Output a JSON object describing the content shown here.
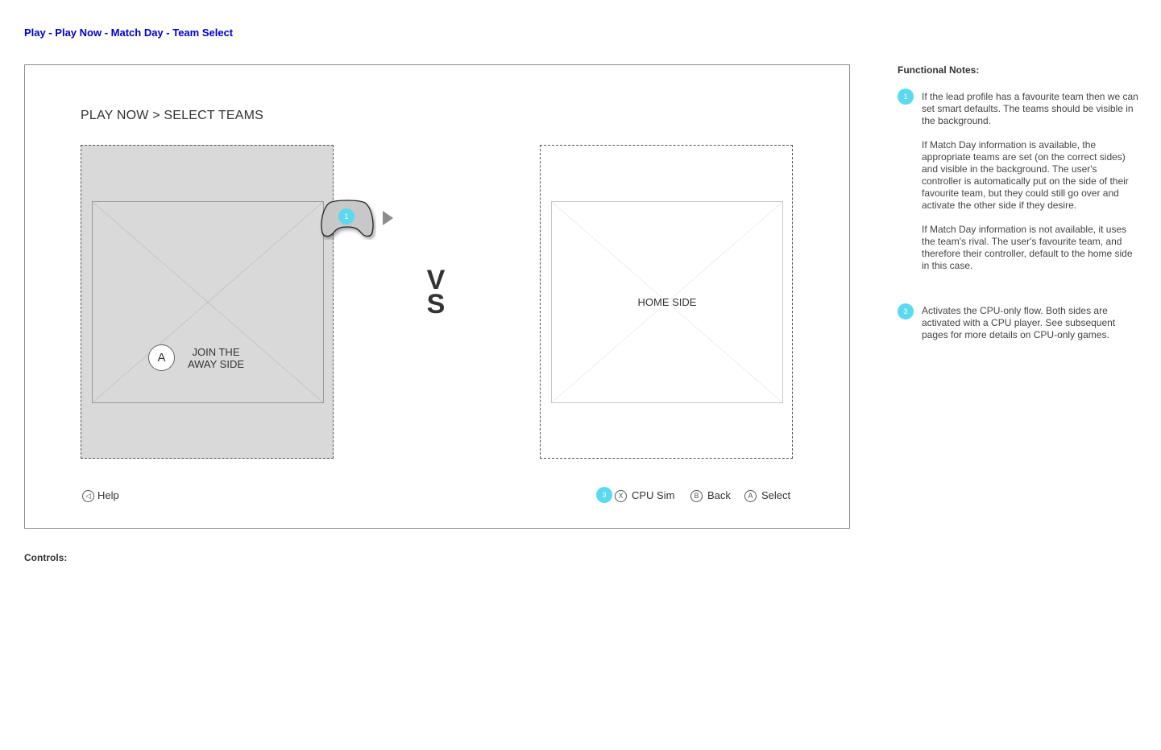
{
  "breadcrumb": "Play - Play Now - Match Day - Team Select",
  "screen": {
    "title": "PLAY NOW > SELECT TEAMS",
    "away_panel": {
      "button_glyph": "A",
      "label_line1": "JOIN THE",
      "label_line2": "AWAY SIDE"
    },
    "home_panel": {
      "label": "HOME SIDE"
    },
    "controller": {
      "icon": "gamepad-icon",
      "badge": "1"
    },
    "vs": {
      "line1": "V",
      "line2": "S"
    },
    "footer": {
      "help": {
        "glyph": "◁",
        "label": "Help"
      },
      "cpu_sim": {
        "badge": "3",
        "glyph": "X",
        "label": "CPU Sim"
      },
      "back": {
        "glyph": "B",
        "label": "Back"
      },
      "select": {
        "glyph": "A",
        "label": "Select"
      }
    }
  },
  "notes": {
    "title": "Functional Notes:",
    "items": [
      {
        "badge": "1",
        "paragraphs": [
          "If the lead profile has a favourite team then we can set smart defaults. The teams should be visible in the background.",
          "If Match Day information is available, the appropriate teams are set (on the correct sides) and visible in the background. The user's controller is automatically put on the side of their favourite team, but they could still go over and activate the other side if they desire.",
          "If Match Day information is not available, it uses the team's rival. The user's favourite team, and therefore their controller, default to the home side in this case."
        ]
      },
      {
        "badge": "3",
        "paragraphs": [
          "Activates the CPU-only flow. Both sides are activated with a CPU player. See subsequent pages for more details on CPU-only games."
        ]
      }
    ]
  },
  "controls": {
    "title": "Controls:"
  },
  "colors": {
    "breadcrumb": "#0000cc",
    "badge": "#5bd9f0",
    "away_panel_bg": "#d9d9d9"
  }
}
